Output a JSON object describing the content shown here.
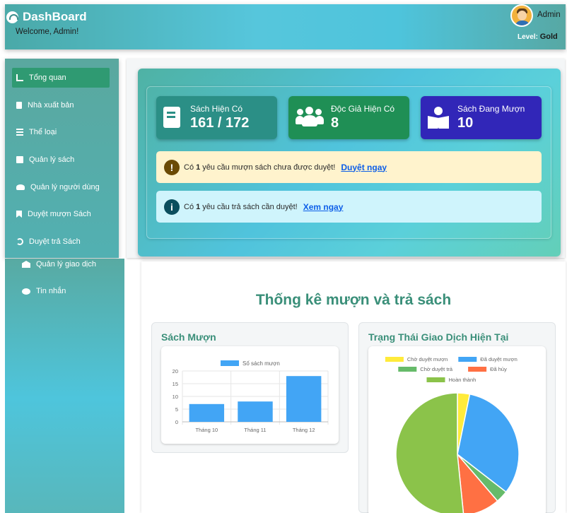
{
  "header": {
    "brand_title": "DashBoard",
    "welcome": "Welcome, Admin!",
    "admin_name": "Admin",
    "level_label": "Level:",
    "level_value": "Gold"
  },
  "sidebar": {
    "items": [
      {
        "label": "Tổng quan",
        "icon": "chart-line-icon",
        "active": true
      },
      {
        "label": "Nhà xuất bản",
        "icon": "building-icon"
      },
      {
        "label": "Thể loại",
        "icon": "list-icon"
      },
      {
        "label": "Quản lý sách",
        "icon": "book-icon"
      },
      {
        "label": "Quản lý người dùng",
        "icon": "users-icon"
      },
      {
        "label": "Duyệt mượn Sách",
        "icon": "bookmark-icon"
      },
      {
        "label": "Duyệt trả Sách",
        "icon": "undo-icon"
      },
      {
        "label": "Quản lý giao dịch",
        "icon": "bank-icon"
      },
      {
        "label": "Tin nhắn",
        "icon": "chat-icon"
      }
    ]
  },
  "stats": {
    "books": {
      "label": "Sách Hiện Có",
      "value": "161 / 172",
      "color": "#2b8f86"
    },
    "readers": {
      "label": "Độc Giả Hiện Có",
      "value": "8",
      "color": "#1f8f55"
    },
    "borrowing": {
      "label": "Sách Đang Mượn",
      "value": "10",
      "color": "#3126b8"
    }
  },
  "alerts": {
    "borrow": {
      "prefix": "Có",
      "count": "1",
      "text": "yêu cầu mượn sách chưa được duyệt!",
      "link": "Duyệt ngay"
    },
    "return": {
      "prefix": "Có",
      "count": "1",
      "text": "yêu cầu trả sách cần duyệt!",
      "link": "Xem ngay"
    }
  },
  "section_title": "Thống kê mượn và trả sách",
  "borrow_card_title": "Sách Mượn",
  "status_card_title": "Trạng Thái Giao Dịch Hiện Tại",
  "chart_data": [
    {
      "type": "bar",
      "categories": [
        "Tháng 10",
        "Tháng 11",
        "Tháng 12"
      ],
      "series": [
        {
          "name": "Số sách mượn",
          "values": [
            7,
            8,
            18
          ]
        }
      ],
      "ylim": [
        0,
        20
      ],
      "yticks": [
        0,
        5,
        10,
        15,
        20
      ],
      "color": "#42a5f5",
      "legend": "top"
    },
    {
      "type": "pie",
      "labels": [
        "Chờ duyệt mượn",
        "Đã duyệt mượn",
        "Chờ duyệt trả",
        "Đã hủy",
        "Hoàn thành"
      ],
      "values": [
        1,
        10,
        1,
        3,
        16
      ],
      "colors": [
        "#ffeb3b",
        "#42a5f5",
        "#66bb6a",
        "#ff7043",
        "#8bc34a"
      ],
      "legend": "top"
    }
  ]
}
